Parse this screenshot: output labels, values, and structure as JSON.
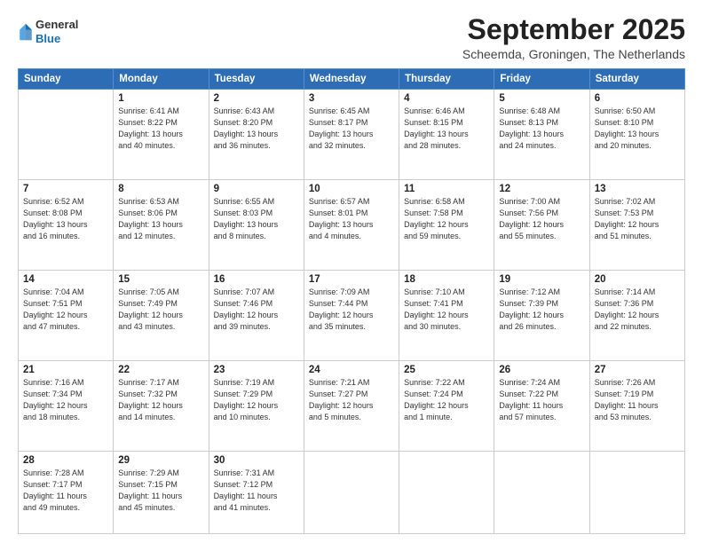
{
  "header": {
    "logo": {
      "line1": "General",
      "line2": "Blue"
    },
    "title": "September 2025",
    "subtitle": "Scheemda, Groningen, The Netherlands"
  },
  "weekdays": [
    "Sunday",
    "Monday",
    "Tuesday",
    "Wednesday",
    "Thursday",
    "Friday",
    "Saturday"
  ],
  "weeks": [
    [
      {
        "day": null,
        "info": ""
      },
      {
        "day": "1",
        "info": "Sunrise: 6:41 AM\nSunset: 8:22 PM\nDaylight: 13 hours\nand 40 minutes."
      },
      {
        "day": "2",
        "info": "Sunrise: 6:43 AM\nSunset: 8:20 PM\nDaylight: 13 hours\nand 36 minutes."
      },
      {
        "day": "3",
        "info": "Sunrise: 6:45 AM\nSunset: 8:17 PM\nDaylight: 13 hours\nand 32 minutes."
      },
      {
        "day": "4",
        "info": "Sunrise: 6:46 AM\nSunset: 8:15 PM\nDaylight: 13 hours\nand 28 minutes."
      },
      {
        "day": "5",
        "info": "Sunrise: 6:48 AM\nSunset: 8:13 PM\nDaylight: 13 hours\nand 24 minutes."
      },
      {
        "day": "6",
        "info": "Sunrise: 6:50 AM\nSunset: 8:10 PM\nDaylight: 13 hours\nand 20 minutes."
      }
    ],
    [
      {
        "day": "7",
        "info": "Sunrise: 6:52 AM\nSunset: 8:08 PM\nDaylight: 13 hours\nand 16 minutes."
      },
      {
        "day": "8",
        "info": "Sunrise: 6:53 AM\nSunset: 8:06 PM\nDaylight: 13 hours\nand 12 minutes."
      },
      {
        "day": "9",
        "info": "Sunrise: 6:55 AM\nSunset: 8:03 PM\nDaylight: 13 hours\nand 8 minutes."
      },
      {
        "day": "10",
        "info": "Sunrise: 6:57 AM\nSunset: 8:01 PM\nDaylight: 13 hours\nand 4 minutes."
      },
      {
        "day": "11",
        "info": "Sunrise: 6:58 AM\nSunset: 7:58 PM\nDaylight: 12 hours\nand 59 minutes."
      },
      {
        "day": "12",
        "info": "Sunrise: 7:00 AM\nSunset: 7:56 PM\nDaylight: 12 hours\nand 55 minutes."
      },
      {
        "day": "13",
        "info": "Sunrise: 7:02 AM\nSunset: 7:53 PM\nDaylight: 12 hours\nand 51 minutes."
      }
    ],
    [
      {
        "day": "14",
        "info": "Sunrise: 7:04 AM\nSunset: 7:51 PM\nDaylight: 12 hours\nand 47 minutes."
      },
      {
        "day": "15",
        "info": "Sunrise: 7:05 AM\nSunset: 7:49 PM\nDaylight: 12 hours\nand 43 minutes."
      },
      {
        "day": "16",
        "info": "Sunrise: 7:07 AM\nSunset: 7:46 PM\nDaylight: 12 hours\nand 39 minutes."
      },
      {
        "day": "17",
        "info": "Sunrise: 7:09 AM\nSunset: 7:44 PM\nDaylight: 12 hours\nand 35 minutes."
      },
      {
        "day": "18",
        "info": "Sunrise: 7:10 AM\nSunset: 7:41 PM\nDaylight: 12 hours\nand 30 minutes."
      },
      {
        "day": "19",
        "info": "Sunrise: 7:12 AM\nSunset: 7:39 PM\nDaylight: 12 hours\nand 26 minutes."
      },
      {
        "day": "20",
        "info": "Sunrise: 7:14 AM\nSunset: 7:36 PM\nDaylight: 12 hours\nand 22 minutes."
      }
    ],
    [
      {
        "day": "21",
        "info": "Sunrise: 7:16 AM\nSunset: 7:34 PM\nDaylight: 12 hours\nand 18 minutes."
      },
      {
        "day": "22",
        "info": "Sunrise: 7:17 AM\nSunset: 7:32 PM\nDaylight: 12 hours\nand 14 minutes."
      },
      {
        "day": "23",
        "info": "Sunrise: 7:19 AM\nSunset: 7:29 PM\nDaylight: 12 hours\nand 10 minutes."
      },
      {
        "day": "24",
        "info": "Sunrise: 7:21 AM\nSunset: 7:27 PM\nDaylight: 12 hours\nand 5 minutes."
      },
      {
        "day": "25",
        "info": "Sunrise: 7:22 AM\nSunset: 7:24 PM\nDaylight: 12 hours\nand 1 minute."
      },
      {
        "day": "26",
        "info": "Sunrise: 7:24 AM\nSunset: 7:22 PM\nDaylight: 11 hours\nand 57 minutes."
      },
      {
        "day": "27",
        "info": "Sunrise: 7:26 AM\nSunset: 7:19 PM\nDaylight: 11 hours\nand 53 minutes."
      }
    ],
    [
      {
        "day": "28",
        "info": "Sunrise: 7:28 AM\nSunset: 7:17 PM\nDaylight: 11 hours\nand 49 minutes."
      },
      {
        "day": "29",
        "info": "Sunrise: 7:29 AM\nSunset: 7:15 PM\nDaylight: 11 hours\nand 45 minutes."
      },
      {
        "day": "30",
        "info": "Sunrise: 7:31 AM\nSunset: 7:12 PM\nDaylight: 11 hours\nand 41 minutes."
      },
      {
        "day": null,
        "info": ""
      },
      {
        "day": null,
        "info": ""
      },
      {
        "day": null,
        "info": ""
      },
      {
        "day": null,
        "info": ""
      }
    ]
  ]
}
